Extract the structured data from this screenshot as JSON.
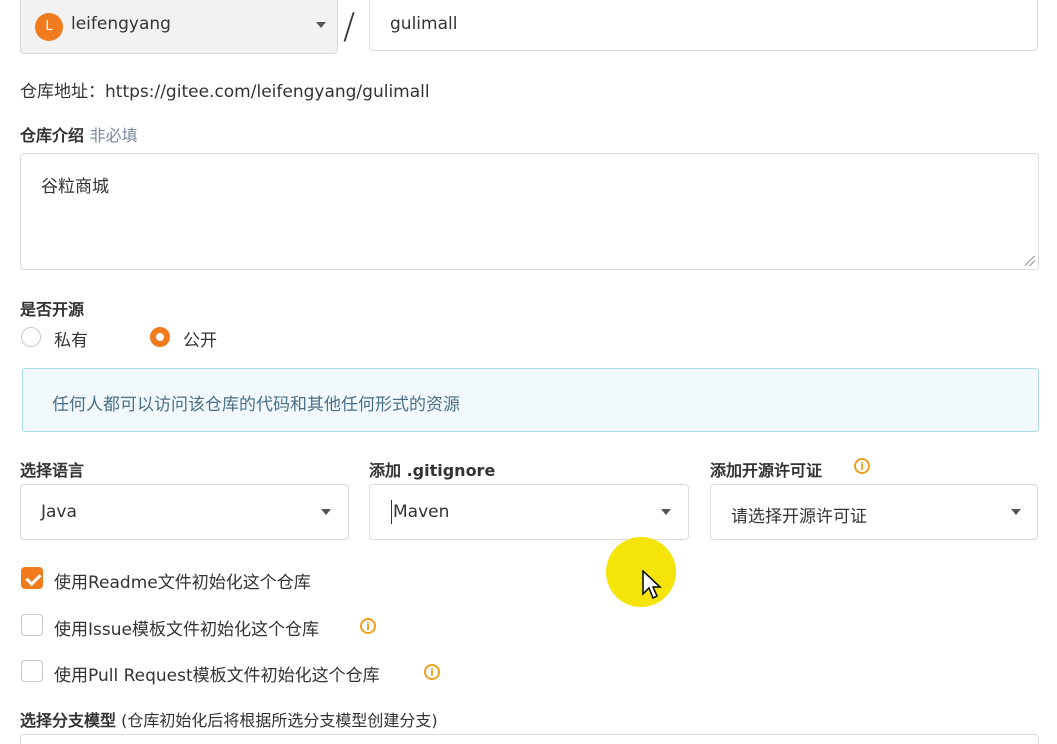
{
  "owner": {
    "avatar_letter": "L",
    "name": "leifengyang"
  },
  "separator": "/",
  "repo_name": "gulimall",
  "address": {
    "label": "仓库地址：",
    "url": "https://gitee.com/leifengyang/gulimall"
  },
  "description": {
    "label": "仓库介绍",
    "hint": "非必填",
    "value": "谷粒商城"
  },
  "visibility": {
    "label": "是否开源",
    "options": [
      {
        "label": "私有",
        "selected": false
      },
      {
        "label": "公开",
        "selected": true
      }
    ],
    "info": "任何人都可以访问该仓库的代码和其他任何形式的资源"
  },
  "language": {
    "label": "选择语言",
    "value": "Java"
  },
  "gitignore": {
    "label": "添加 .gitignore",
    "value": "Maven"
  },
  "license": {
    "label": "添加开源许可证",
    "value": "请选择开源许可证"
  },
  "init_options": [
    {
      "label": "使用Readme文件初始化这个仓库",
      "checked": true
    },
    {
      "label": "使用Issue模板文件初始化这个仓库",
      "checked": false
    },
    {
      "label": "使用Pull Request模板文件初始化这个仓库",
      "checked": false
    }
  ],
  "branch_model": {
    "label": "选择分支模型",
    "hint": "(仓库初始化后将根据所选分支模型创建分支)"
  },
  "colors": {
    "accent": "#f07b1d",
    "info_bg": "#f1f9fc",
    "info_border": "#a9d8e6",
    "info_icon": "#f0a020"
  }
}
